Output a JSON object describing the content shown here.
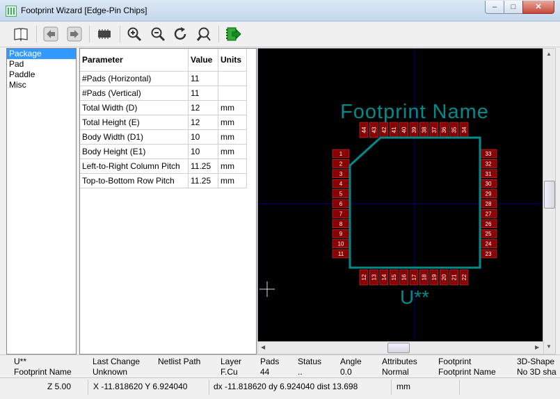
{
  "window": {
    "title": "Footprint Wizard [Edge-Pin Chips]"
  },
  "toolbar": {
    "icons": [
      "book-icon",
      "arrow-left-icon",
      "arrow-right-icon",
      "chip-icon",
      "zoom-in-icon",
      "zoom-out-icon",
      "redraw-icon",
      "zoom-fit-icon",
      "export-icon"
    ]
  },
  "pages": [
    "Package",
    "Pad",
    "Paddle",
    "Misc"
  ],
  "params": {
    "headers": [
      "Parameter",
      "Value",
      "Units"
    ],
    "rows": [
      [
        "#Pads (Horizontal)",
        "11",
        ""
      ],
      [
        "#Pads (Vertical)",
        "11",
        ""
      ],
      [
        "Total Width (D)",
        "12",
        "mm"
      ],
      [
        "Total Height (E)",
        "12",
        "mm"
      ],
      [
        "Body Width (D1)",
        "10",
        "mm"
      ],
      [
        "Body Height (E1)",
        "10",
        "mm"
      ],
      [
        "Left-to-Right Column Pitch",
        "11.25",
        "mm"
      ],
      [
        "Top-to-Bottom Row Pitch",
        "11.25",
        "mm"
      ]
    ]
  },
  "preview": {
    "value_text": "Footprint Name",
    "ref_text": "U**",
    "top_pads": [
      "44",
      "43",
      "42",
      "41",
      "40",
      "39",
      "38",
      "37",
      "36",
      "35",
      "34"
    ],
    "left_pads": [
      "1",
      "2",
      "3",
      "4",
      "5",
      "6",
      "7",
      "8",
      "9",
      "10",
      "11"
    ],
    "bottom_pads": [
      "12",
      "13",
      "14",
      "15",
      "16",
      "17",
      "18",
      "19",
      "20",
      "21",
      "22"
    ],
    "right_pads": [
      "33",
      "32",
      "31",
      "30",
      "29",
      "28",
      "27",
      "26",
      "25",
      "24",
      "23"
    ],
    "colors": {
      "pad": "#8b0000",
      "silk": "#008b8b",
      "bg": "#000000",
      "axis": "#000080"
    }
  },
  "status": {
    "columns": [
      {
        "label": "U**",
        "value": "Footprint Name",
        "color": "#000080"
      },
      {
        "label": "Last Change",
        "value": "Unknown",
        "color": "#808000"
      },
      {
        "label": "Netlist Path",
        "value": "",
        "color": "#808000"
      },
      {
        "label": "Layer",
        "value": "F.Cu",
        "color": "#800000"
      },
      {
        "label": "Pads",
        "value": "44",
        "color": "#000080"
      },
      {
        "label": "Status",
        "value": "..",
        "color": "#800080"
      },
      {
        "label": "Angle",
        "value": "0.0",
        "color": "#808000"
      },
      {
        "label": "Attributes",
        "value": "Normal",
        "color": "#808000"
      },
      {
        "label": "Footprint",
        "value": "Footprint Name",
        "color": "#000080"
      },
      {
        "label": "3D-Shape",
        "value": "No 3D sha",
        "color": "#800000"
      }
    ]
  },
  "bottom": {
    "zoom": "Z 5.00",
    "xy": "X -11.818620  Y 6.924040",
    "delta": "dx -11.818620  dy 6.924040  dist 13.698",
    "units": "mm"
  }
}
